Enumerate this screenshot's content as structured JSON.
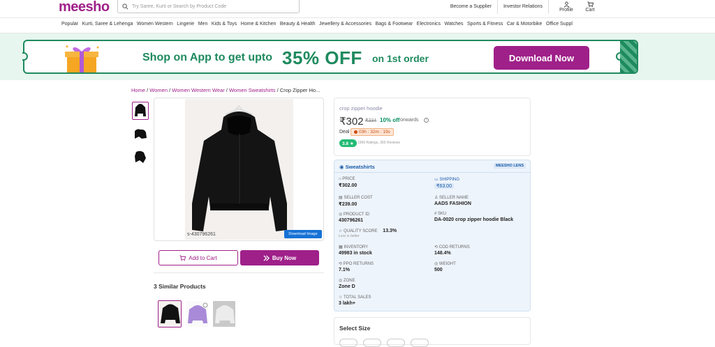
{
  "header": {
    "logo": "meesho",
    "search_placeholder": "Try Saree, Kurti or Search by Product Code",
    "links": [
      "Become a Supplier",
      "Investor Relations"
    ],
    "profile_label": "Profile",
    "cart_label": "Cart"
  },
  "categories": [
    "Popular",
    "Kurti, Saree & Lehenga",
    "Women Western",
    "Lingerie",
    "Men",
    "Kids & Toys",
    "Home & Kitchen",
    "Beauty & Health",
    "Jewellery & Accessories",
    "Bags & Footwear",
    "Electronics",
    "Watches",
    "Sports & Fitness",
    "Car & Motorbike",
    "Office Suppl"
  ],
  "banner": {
    "text1": "Shop on App to get upto",
    "text2": "35% OFF",
    "text3": "on 1st order",
    "button": "Download Now"
  },
  "breadcrumbs": [
    "Home",
    "Women",
    "Women Western Wear",
    "Women Sweatshirts",
    "Crop Zipper Ho..."
  ],
  "gallery": {
    "product_id_text": "s-430796261",
    "download_image": "Download Image"
  },
  "actions": {
    "add_to_cart": "Add to Cart",
    "buy_now": "Buy Now"
  },
  "similar": {
    "title": "3 Similar Products"
  },
  "product": {
    "title": "crop zipper hoodie",
    "price": "₹302",
    "mrp": "₹334",
    "discount": "10% off",
    "onwards": "onwards",
    "deal_label": "Deal",
    "deal_timer": "03h : 32m : 19s",
    "rating": "3.8 ★",
    "rating_text": "1999 Ratings, 365 Reviews"
  },
  "lens": {
    "title": "Sweatshirts",
    "badge": "MEESHO LENS",
    "fields": {
      "price": {
        "label": "PRICE",
        "value": "₹302.00"
      },
      "shipping": {
        "label": "SHIPPING",
        "value": "₹63.00"
      },
      "seller_cost": {
        "label": "SELLER COST",
        "value": "₹239.00"
      },
      "seller_name": {
        "label": "SELLER NAME",
        "value": "AADS FASHION"
      },
      "product_id": {
        "label": "PRODUCT ID",
        "value": "430796261"
      },
      "sku": {
        "label": "SKU",
        "value": "DA-0020 crop zipper hoodie Black"
      },
      "quality_score": {
        "label": "QUALITY SCORE",
        "value": "13.3%",
        "note": "Less is better"
      },
      "inventory": {
        "label": "INVENTORY",
        "value": "49983 in stock"
      },
      "cod_returns": {
        "label": "COD RETURNS",
        "value": "148.4%"
      },
      "ppo_returns": {
        "label": "PPO RETURNS",
        "value": "7.1%"
      },
      "weight": {
        "label": "WEIGHT",
        "value": "500"
      },
      "zone": {
        "label": "ZONE",
        "value": "Zone D"
      },
      "total_sales": {
        "label": "TOTAL SALES",
        "value": "3 lakh+"
      }
    }
  },
  "size": {
    "title": "Select Size"
  },
  "colors": {
    "brand": "#9f2089",
    "green": "#1e8a5e",
    "lens_blue": "#1a5ba8"
  }
}
